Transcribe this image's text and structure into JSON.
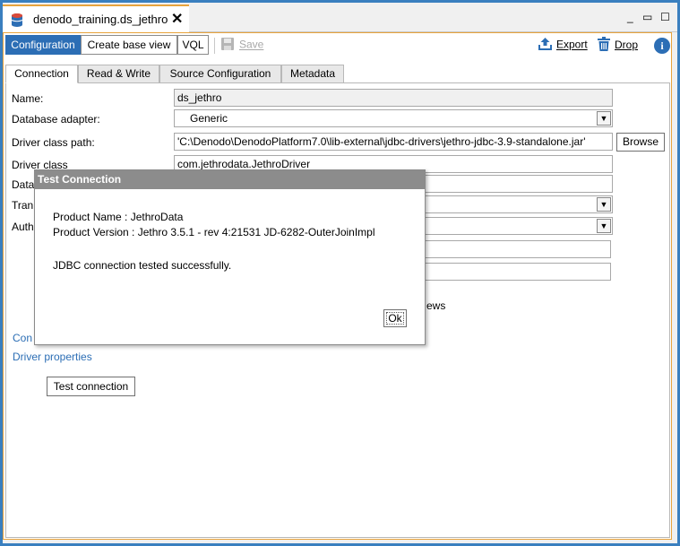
{
  "window": {
    "tab_title": "denodo_training.ds_jethro",
    "close_glyph": "✕",
    "minimize_glyph": "_",
    "restore_glyph": "▭",
    "maximize_glyph": "☐"
  },
  "toolbar": {
    "configuration_label": "Configuration",
    "create_base_view_label": "Create base view",
    "vql_label": "VQL",
    "save_label": "Save",
    "export_label": "Export",
    "drop_label": "Drop",
    "info_glyph": "i"
  },
  "subtabs": {
    "connection": "Connection",
    "read_write": "Read & Write",
    "source_configuration": "Source Configuration",
    "metadata": "Metadata"
  },
  "form": {
    "name_label": "Name:",
    "name_value": "ds_jethro",
    "adapter_label": "Database adapter:",
    "adapter_value": "Generic",
    "driver_path_label": "Driver class path:",
    "driver_path_value": "'C:\\Denodo\\DenodoPlatform7.0\\lib-external\\jdbc-drivers\\jethro-jdbc-3.9-standalone.jar'",
    "browse_label": "Browse",
    "driver_class_label": "Driver class",
    "driver_class_value": "com.jethrodata.JethroDriver",
    "database_uri_label_partial": "Data",
    "transaction_label_partial": "Tran",
    "authentication_label_partial": "Auth",
    "views_text_partial": "ews",
    "connection_pool_link_partial": "Con",
    "driver_properties_link": "Driver properties",
    "test_connection_label": "Test connection"
  },
  "dialog": {
    "title": "Test Connection",
    "product_name": "Product Name : JethroData",
    "product_version": "Product Version : Jethro 3.5.1 - rev 4:21531 JD-6282-OuterJoinImpl",
    "message": "JDBC connection tested successfully.",
    "ok_label": "Ok"
  },
  "colors": {
    "accent_blue": "#2c6eb5",
    "frame_blue": "#3a7fbf",
    "active_tab_border": "#e8a33c",
    "dialog_header": "#8c8c8c"
  },
  "icons": [
    "database-icon",
    "save-icon",
    "export-icon",
    "drop-icon",
    "info-icon",
    "chevron-down-icon"
  ]
}
